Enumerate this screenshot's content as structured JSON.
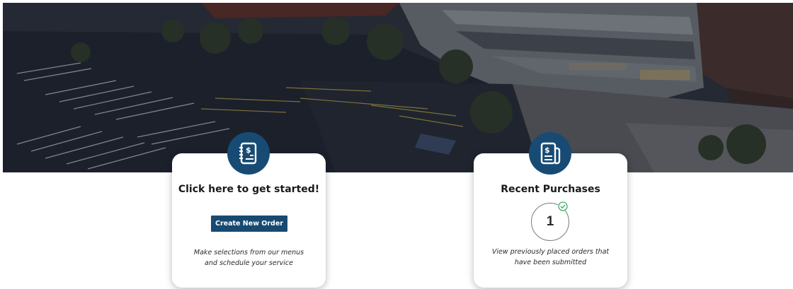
{
  "hero": {
    "image_description": "aerial-campus-parking-lot-photo"
  },
  "cards": {
    "start": {
      "icon": "receipt-dollar-icon",
      "title": "Click here to get started!",
      "button_label": "Create New Order",
      "description_line1": "Make selections from our menus",
      "description_line2": "and schedule your service"
    },
    "recent": {
      "icon": "receipt-document-icon",
      "title": "Recent Purchases",
      "count": "1",
      "status_icon": "check-circle-icon",
      "description_line1": "View previously placed orders that",
      "description_line2": "have been submitted"
    }
  },
  "colors": {
    "accent": "#174b73",
    "button": "#184a71",
    "check": "#3cb371"
  }
}
